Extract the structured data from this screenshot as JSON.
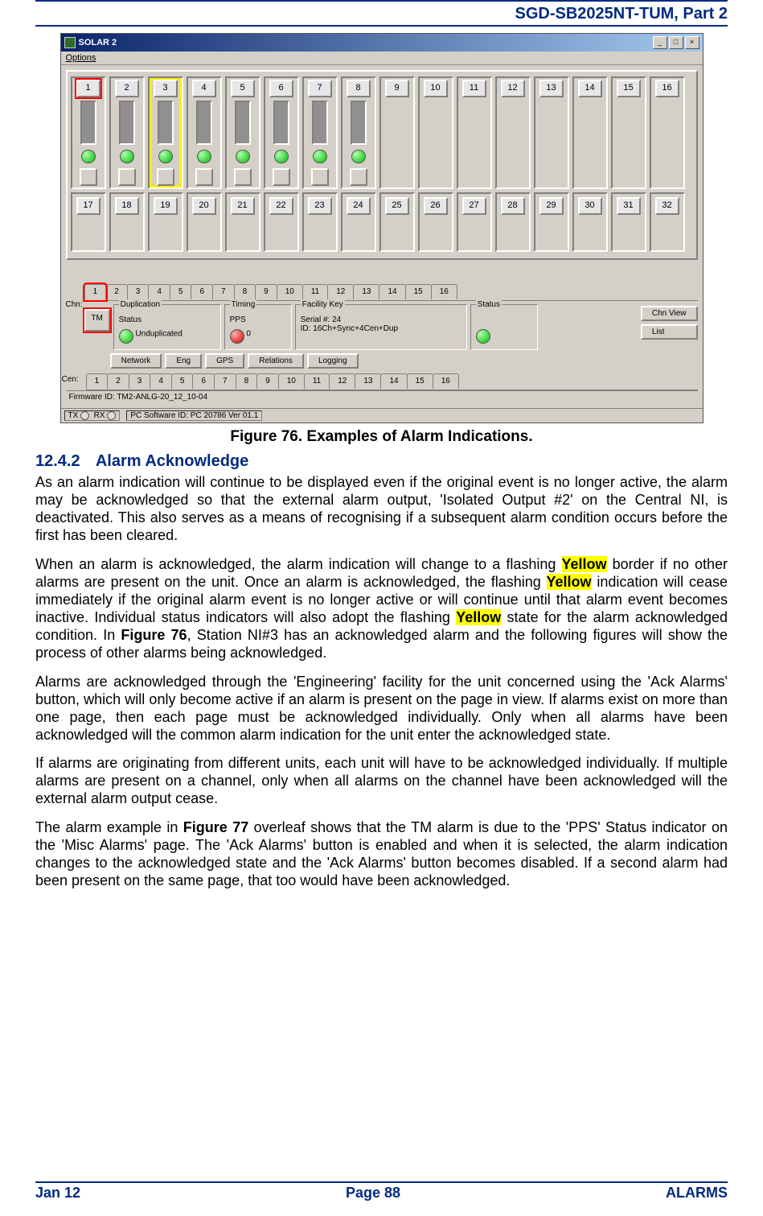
{
  "header": {
    "doc_id": "SGD-SB2025NT-TUM, Part 2"
  },
  "window": {
    "title": "SOLAR 2",
    "menu_options": "Options",
    "win_buttons": {
      "min": "_",
      "max": "□",
      "close": "×"
    },
    "slots_top": [
      {
        "n": "1",
        "active": true,
        "hl": "red"
      },
      {
        "n": "2",
        "active": true
      },
      {
        "n": "3",
        "active": true,
        "hl": "yellow"
      },
      {
        "n": "4",
        "active": true
      },
      {
        "n": "5",
        "active": true
      },
      {
        "n": "6",
        "active": true
      },
      {
        "n": "7",
        "active": true
      },
      {
        "n": "8",
        "active": true
      },
      {
        "n": "9",
        "active": false
      },
      {
        "n": "10",
        "active": false
      },
      {
        "n": "11",
        "active": false
      },
      {
        "n": "12",
        "active": false
      },
      {
        "n": "13",
        "active": false
      },
      {
        "n": "14",
        "active": false
      },
      {
        "n": "15",
        "active": false
      },
      {
        "n": "16",
        "active": false
      }
    ],
    "slots_bottom": [
      "17",
      "18",
      "19",
      "20",
      "21",
      "22",
      "23",
      "24",
      "25",
      "26",
      "27",
      "28",
      "29",
      "30",
      "31",
      "32"
    ],
    "chn_label": "Chn:",
    "chn_tabs": [
      "1",
      "2",
      "3",
      "4",
      "5",
      "6",
      "7",
      "8",
      "9",
      "10",
      "11",
      "12",
      "13",
      "14",
      "15",
      "16"
    ],
    "tm_label": "TM",
    "groups": {
      "duplication": {
        "cap": "Duplication",
        "status_lbl": "Status",
        "status_val": "Unduplicated"
      },
      "timing": {
        "cap": "Timing",
        "pps_lbl": "PPS",
        "pps_val": "0"
      },
      "facility": {
        "cap": "Facility Key",
        "serial_lbl": "Serial #:",
        "serial_val": "24",
        "id_lbl": "ID:",
        "id_val": "16Ch+Sync+4Cen+Dup"
      },
      "status": {
        "cap": "Status"
      }
    },
    "side_buttons": {
      "chnview": "Chn View",
      "list": "List"
    },
    "bottom_buttons": [
      "Network",
      "Eng",
      "GPS",
      "Relations",
      "Logging"
    ],
    "cen_label": "Cen:",
    "cen_tabs": [
      "1",
      "2",
      "3",
      "4",
      "5",
      "6",
      "7",
      "8",
      "9",
      "10",
      "11",
      "12",
      "13",
      "14",
      "15",
      "16"
    ],
    "firmware": "Firmware ID: TM2-ANLG-20_12_10-04",
    "statusbar": {
      "tx": "TX",
      "rx": "RX",
      "pcsw": "PC Software ID: PC 20786  Ver 01.1"
    }
  },
  "figure_caption": "Figure 76.  Examples of Alarm Indications.",
  "section": {
    "num": "12.4.2",
    "title": "Alarm Acknowledge"
  },
  "paras": {
    "p1": "As an alarm indication will continue to be displayed even if the original event is no longer active, the alarm may be acknowledged so that the external alarm output, 'Isolated Output #2' on the Central NI, is deactivated.  This also serves as a means of recognising if a subsequent alarm condition occurs before the first has been cleared.",
    "p2a": "When an alarm is acknowledged, the alarm indication will change to a flashing ",
    "p2_y1": "Yellow",
    "p2b": " border if no other alarms are present on the unit.  Once an alarm is acknowledged, the flashing ",
    "p2_y2": "Yellow",
    "p2c": " indication will cease immediately if the original alarm event is no longer active or will continue until that alarm event becomes inactive.  Individual status indicators will also adopt the flashing ",
    "p2_y3": "Yellow",
    "p2d": " state for the alarm acknowledged condition.  In ",
    "p2_fig": "Figure 76",
    "p2e": ", Station NI#3 has an acknowledged alarm and the following figures will show the process of other alarms being acknowledged.",
    "p3": "Alarms are acknowledged through the 'Engineering' facility for the unit concerned using the 'Ack Alarms' button, which will only become active if an alarm is present on the page in view.  If alarms exist on more than one page, then each page must be acknowledged individually.  Only when all alarms have been acknowledged will the common alarm indication for the unit enter the acknowledged state.",
    "p4": "If alarms are originating from different units, each unit will have to be acknowledged individually.  If multiple alarms are present on a channel, only when all alarms on the channel have been acknowledged will the external alarm output cease.",
    "p5a": "The alarm example in ",
    "p5_fig": "Figure 77",
    "p5b": " overleaf shows that the TM alarm is due to the 'PPS' Status indicator on the 'Misc Alarms' page.  The 'Ack Alarms' button is enabled and when it is selected, the alarm indication changes to the acknowledged state and the 'Ack Alarms' button becomes disabled.  If a second alarm had been present on the same page, that too would have been acknowledged."
  },
  "footer": {
    "left": "Jan 12",
    "mid": "Page 88",
    "right": "ALARMS"
  }
}
